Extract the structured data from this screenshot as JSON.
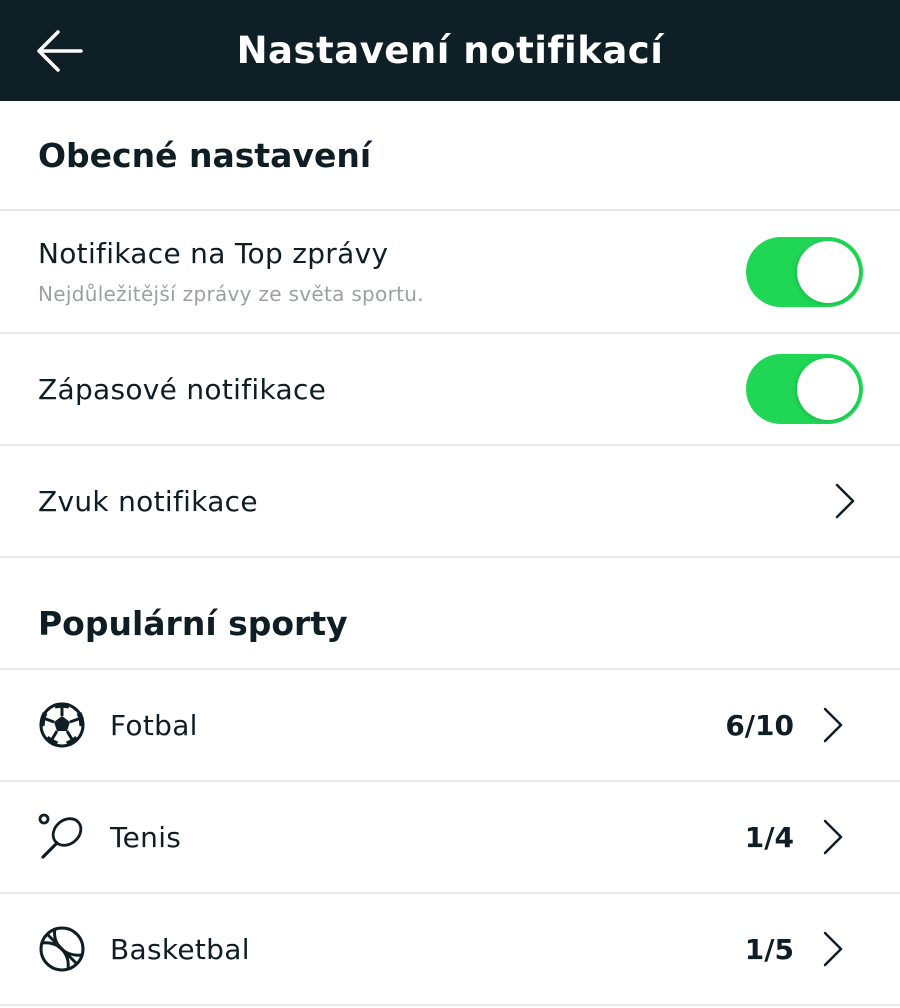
{
  "header": {
    "title": "Nastavení notifikací"
  },
  "general": {
    "title": "Obecné nastavení",
    "top_news": {
      "label": "Notifikace na Top zprávy",
      "subtitle": "Nejdůležitější zprávy ze světa sportu.",
      "enabled": true
    },
    "match": {
      "label": "Zápasové notifikace",
      "enabled": true
    },
    "sound": {
      "label": "Zvuk notifikace"
    }
  },
  "popular": {
    "title": "Populární sporty",
    "items": [
      {
        "label": "Fotbal",
        "count": "6/10",
        "icon": "soccer-ball-icon"
      },
      {
        "label": "Tenis",
        "count": "1/4",
        "icon": "tennis-racket-icon"
      },
      {
        "label": "Basketbal",
        "count": "1/5",
        "icon": "basketball-icon"
      }
    ]
  },
  "colors": {
    "header_bg": "#0f1f26",
    "toggle_on": "#1fd655",
    "divider": "#e6e8e9",
    "subtitle": "#9aa1a5"
  }
}
